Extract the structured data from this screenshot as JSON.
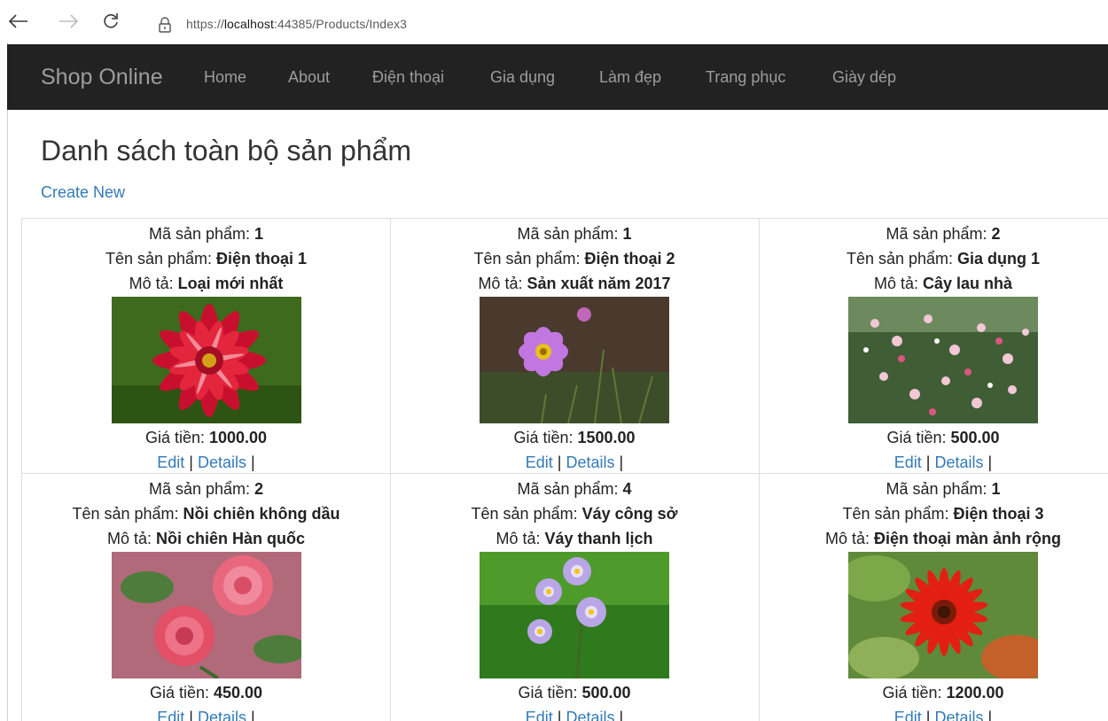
{
  "browser": {
    "url_prefix": "https://",
    "url_host": "localhost",
    "url_rest": ":44385/Products/Index3"
  },
  "navbar": {
    "brand": "Shop Online",
    "items": [
      "Home",
      "About",
      "Điện thoại",
      "Gia dụng",
      "Làm đẹp",
      "Trang phục",
      "Giày dép"
    ]
  },
  "page": {
    "title": "Danh sách toàn bộ sản phẩm",
    "create_link": "Create New"
  },
  "labels": {
    "code": "Mã sản phẩm: ",
    "name": "Tên sản phẩm: ",
    "desc": "Mô tả: ",
    "price": "Giá tiền: ",
    "edit": "Edit",
    "separator": "|",
    "details": "Details",
    "trailing": "|"
  },
  "products": [
    {
      "code": "1",
      "name": "Điện thoại 1",
      "desc": "Loại mới nhất",
      "price": "1000.00",
      "image": "red-dahlia-image"
    },
    {
      "code": "1",
      "name": "Điện thoại 2",
      "desc": "Sản xuất năm 2017",
      "price": "1500.00",
      "image": "purple-cosmos-image"
    },
    {
      "code": "2",
      "name": "Gia dụng 1",
      "desc": "Cây lau nhà",
      "price": "500.00",
      "image": "pink-wildflowers-image"
    },
    {
      "code": "2",
      "name": "Nồi chiên không dầu",
      "desc": "Nồi chiên Hàn quốc",
      "price": "450.00",
      "image": "pink-roses-image"
    },
    {
      "code": "4",
      "name": "Váy công sở",
      "desc": "Váy thanh lịch",
      "price": "500.00",
      "image": "lilac-blossoms-image"
    },
    {
      "code": "1",
      "name": "Điện thoại 3",
      "desc": "Điện thoại màn ảnh rộng",
      "price": "1200.00",
      "image": "red-gerbera-image"
    }
  ],
  "colors": {
    "navbar_bg": "#222222",
    "nav_text": "#9d9d9d",
    "link": "#337ab7"
  }
}
